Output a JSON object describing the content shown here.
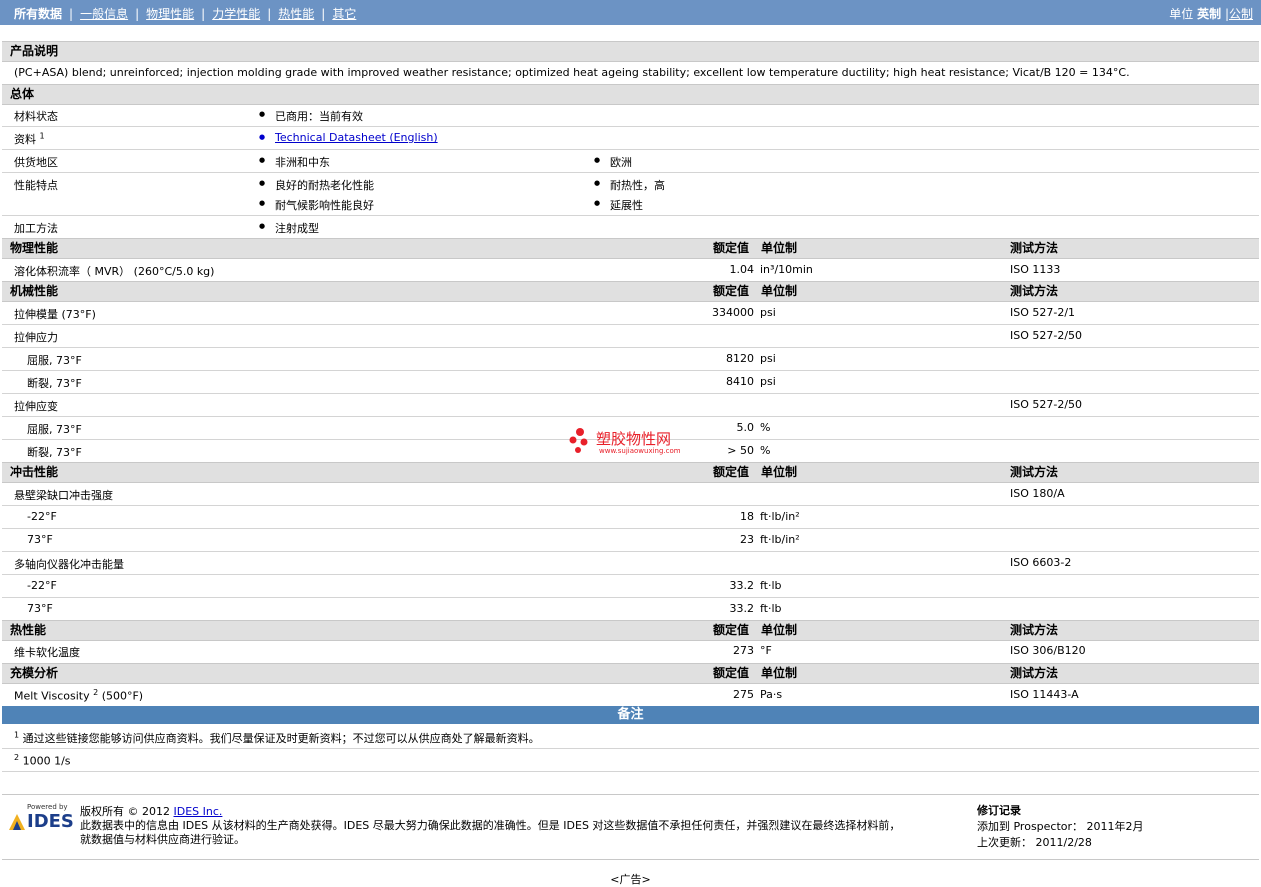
{
  "nav": {
    "items": [
      "所有数据",
      "一般信息",
      "物理性能",
      "力学性能",
      "热性能",
      "其它"
    ],
    "units_label": "单位",
    "units_active": "英制",
    "units_other": "公制"
  },
  "product": {
    "heading": "产品说明",
    "text": "(PC+ASA) blend; unreinforced; injection molding grade with improved weather resistance; optimized heat ageing stability; excellent low temperature ductility; high heat resistance; Vicat/B 120 = 134°C."
  },
  "general": {
    "heading": "总体",
    "material_status_label": "材料状态",
    "material_status_value": "已商用：当前有效",
    "docs_label": "资料",
    "docs_sup": "1",
    "docs_link": "Technical Datasheet (English)",
    "supply_label": "供货地区",
    "supply_values": [
      "非洲和中东",
      "欧洲"
    ],
    "features_label": "性能特点",
    "features_values": [
      "良好的耐热老化性能",
      "耐热性，高",
      "耐气候影响性能良好",
      "延展性"
    ],
    "process_label": "加工方法",
    "process_value": "注射成型"
  },
  "col_headers": {
    "nominal": "额定值",
    "unit": "单位制",
    "method": "测试方法"
  },
  "physical": {
    "heading": "物理性能",
    "rows": [
      {
        "label": "溶化体积流率（ MVR）  (260°C/5.0 kg)",
        "value": "1.04",
        "unit": "in³/10min",
        "method": "ISO 1133"
      }
    ]
  },
  "mechanical": {
    "heading": "机械性能",
    "modulus": {
      "label": "拉伸模量  (73°F)",
      "value": "334000",
      "unit": "psi",
      "method": "ISO 527-2/1"
    },
    "stress": {
      "label": "拉伸应力",
      "method": "ISO 527-2/50",
      "yield": {
        "label": "屈服, 73°F",
        "value": "8120",
        "unit": "psi"
      },
      "break": {
        "label": "断裂, 73°F",
        "value": "8410",
        "unit": "psi"
      }
    },
    "strain": {
      "label": "拉伸应变",
      "method": "ISO 527-2/50",
      "yield": {
        "label": "屈服, 73°F",
        "value": "5.0",
        "unit": "%"
      },
      "break": {
        "label": "断裂, 73°F",
        "value": "> 50",
        "unit": "%"
      }
    }
  },
  "impact": {
    "heading": "冲击性能",
    "izod": {
      "label": "悬壁梁缺口冲击强度",
      "method": "ISO 180/A",
      "r1": {
        "label": "-22°F",
        "value": "18",
        "unit": "ft·lb/in²"
      },
      "r2": {
        "label": "73°F",
        "value": "23",
        "unit": "ft·lb/in²"
      }
    },
    "multi": {
      "label": "多轴向仪器化冲击能量",
      "method": "ISO 6603-2",
      "r1": {
        "label": "-22°F",
        "value": "33.2",
        "unit": "ft·lb"
      },
      "r2": {
        "label": "73°F",
        "value": "33.2",
        "unit": "ft·lb"
      }
    }
  },
  "thermal": {
    "heading": "热性能",
    "vicat": {
      "label": "维卡软化温度",
      "value": "273",
      "unit": "°F",
      "method": "ISO 306/B120"
    }
  },
  "fill": {
    "heading": "充模分析",
    "visc": {
      "label": "Melt Viscosity",
      "sup": "2",
      "cond": "(500°F)",
      "value": "275",
      "unit": "Pa·s",
      "method": "ISO 11443-A"
    }
  },
  "notes": {
    "heading": "备注",
    "n1_sup": "1",
    "n1": "通过这些链接您能够访问供应商资料。我们尽量保证及时更新资料；不过您可以从供应商处了解最新资料。",
    "n2_sup": "2",
    "n2": "1000 1/s"
  },
  "footer": {
    "powered": "Powered by",
    "logo": "IDES",
    "copyright_prefix": "版权所有  © 2012",
    "copyright_link": "IDES Inc.",
    "disclaimer1": "此数据表中的信息由  IDES 从该材料的生产商处获得。IDES 尽最大努力确保此数据的准确性。但是  IDES 对这些数据值不承担任何责任，并强烈建议在最终选择材料前，",
    "disclaimer2": "就数据值与材料供应商进行验证。",
    "rev_heading": "修订记录",
    "added_label": "添加到  Prospector：",
    "added_value": "2011年2月",
    "updated_label": "上次更新：",
    "updated_value": "2011/2/28",
    "ad": "<广告>"
  },
  "watermark": {
    "name": "塑胶物性网",
    "url": "www.sujiaowuxing.com"
  },
  "colors": {
    "topbar": "#6c93c4",
    "notesbar": "#4f83b7",
    "section": "#e0e0e0",
    "link": "#0000cc",
    "watermark": "#e8202a"
  }
}
